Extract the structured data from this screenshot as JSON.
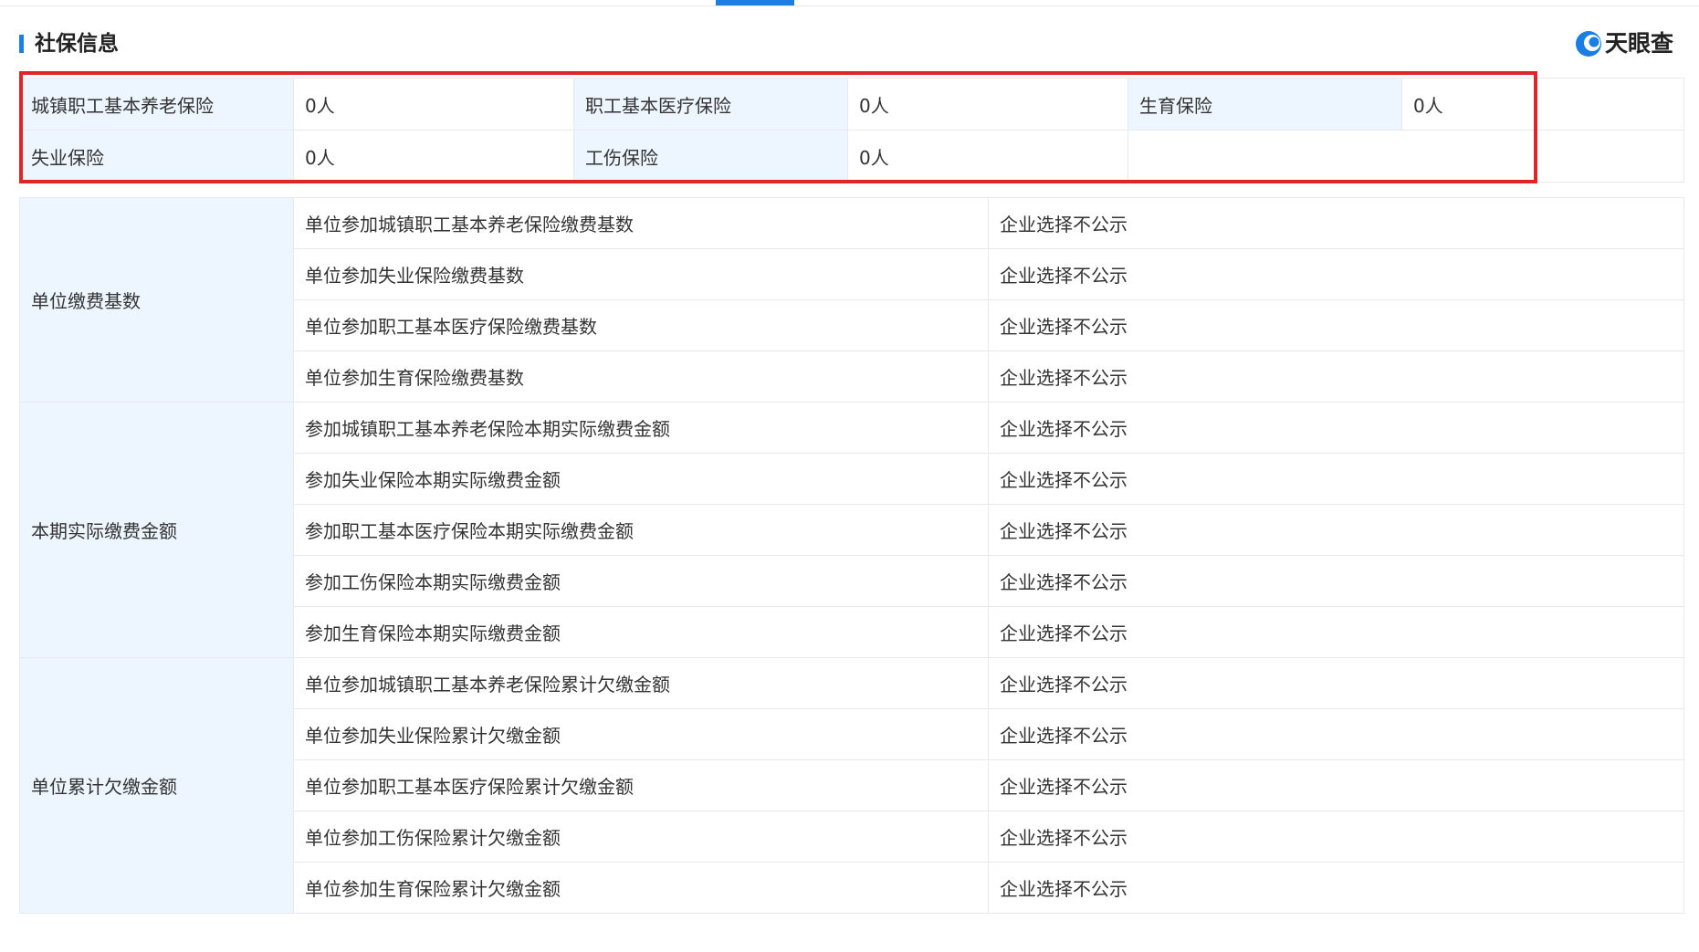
{
  "header": {
    "title": "社保信息",
    "logo_text": "天眼查",
    "accent_color": "#1a7ee4",
    "highlight_color": "#e0242b"
  },
  "summary": [
    [
      {
        "label": "城镇职工基本养老保险",
        "value": "0人"
      },
      {
        "label": "职工基本医疗保险",
        "value": "0人"
      },
      {
        "label": "生育保险",
        "value": "0人"
      }
    ],
    [
      {
        "label": "失业保险",
        "value": "0人"
      },
      {
        "label": "工伤保险",
        "value": "0人"
      }
    ]
  ],
  "details": [
    {
      "group": "单位缴费基数",
      "rows": [
        {
          "item": "单位参加城镇职工基本养老保险缴费基数",
          "value": "企业选择不公示"
        },
        {
          "item": "单位参加失业保险缴费基数",
          "value": "企业选择不公示"
        },
        {
          "item": "单位参加职工基本医疗保险缴费基数",
          "value": "企业选择不公示"
        },
        {
          "item": "单位参加生育保险缴费基数",
          "value": "企业选择不公示"
        }
      ]
    },
    {
      "group": "本期实际缴费金额",
      "rows": [
        {
          "item": "参加城镇职工基本养老保险本期实际缴费金额",
          "value": "企业选择不公示"
        },
        {
          "item": "参加失业保险本期实际缴费金额",
          "value": "企业选择不公示"
        },
        {
          "item": "参加职工基本医疗保险本期实际缴费金额",
          "value": "企业选择不公示"
        },
        {
          "item": "参加工伤保险本期实际缴费金额",
          "value": "企业选择不公示"
        },
        {
          "item": "参加生育保险本期实际缴费金额",
          "value": "企业选择不公示"
        }
      ]
    },
    {
      "group": "单位累计欠缴金额",
      "rows": [
        {
          "item": "单位参加城镇职工基本养老保险累计欠缴金额",
          "value": "企业选择不公示"
        },
        {
          "item": "单位参加失业保险累计欠缴金额",
          "value": "企业选择不公示"
        },
        {
          "item": "单位参加职工基本医疗保险累计欠缴金额",
          "value": "企业选择不公示"
        },
        {
          "item": "单位参加工伤保险累计欠缴金额",
          "value": "企业选择不公示"
        },
        {
          "item": "单位参加生育保险累计欠缴金额",
          "value": "企业选择不公示"
        }
      ]
    }
  ]
}
